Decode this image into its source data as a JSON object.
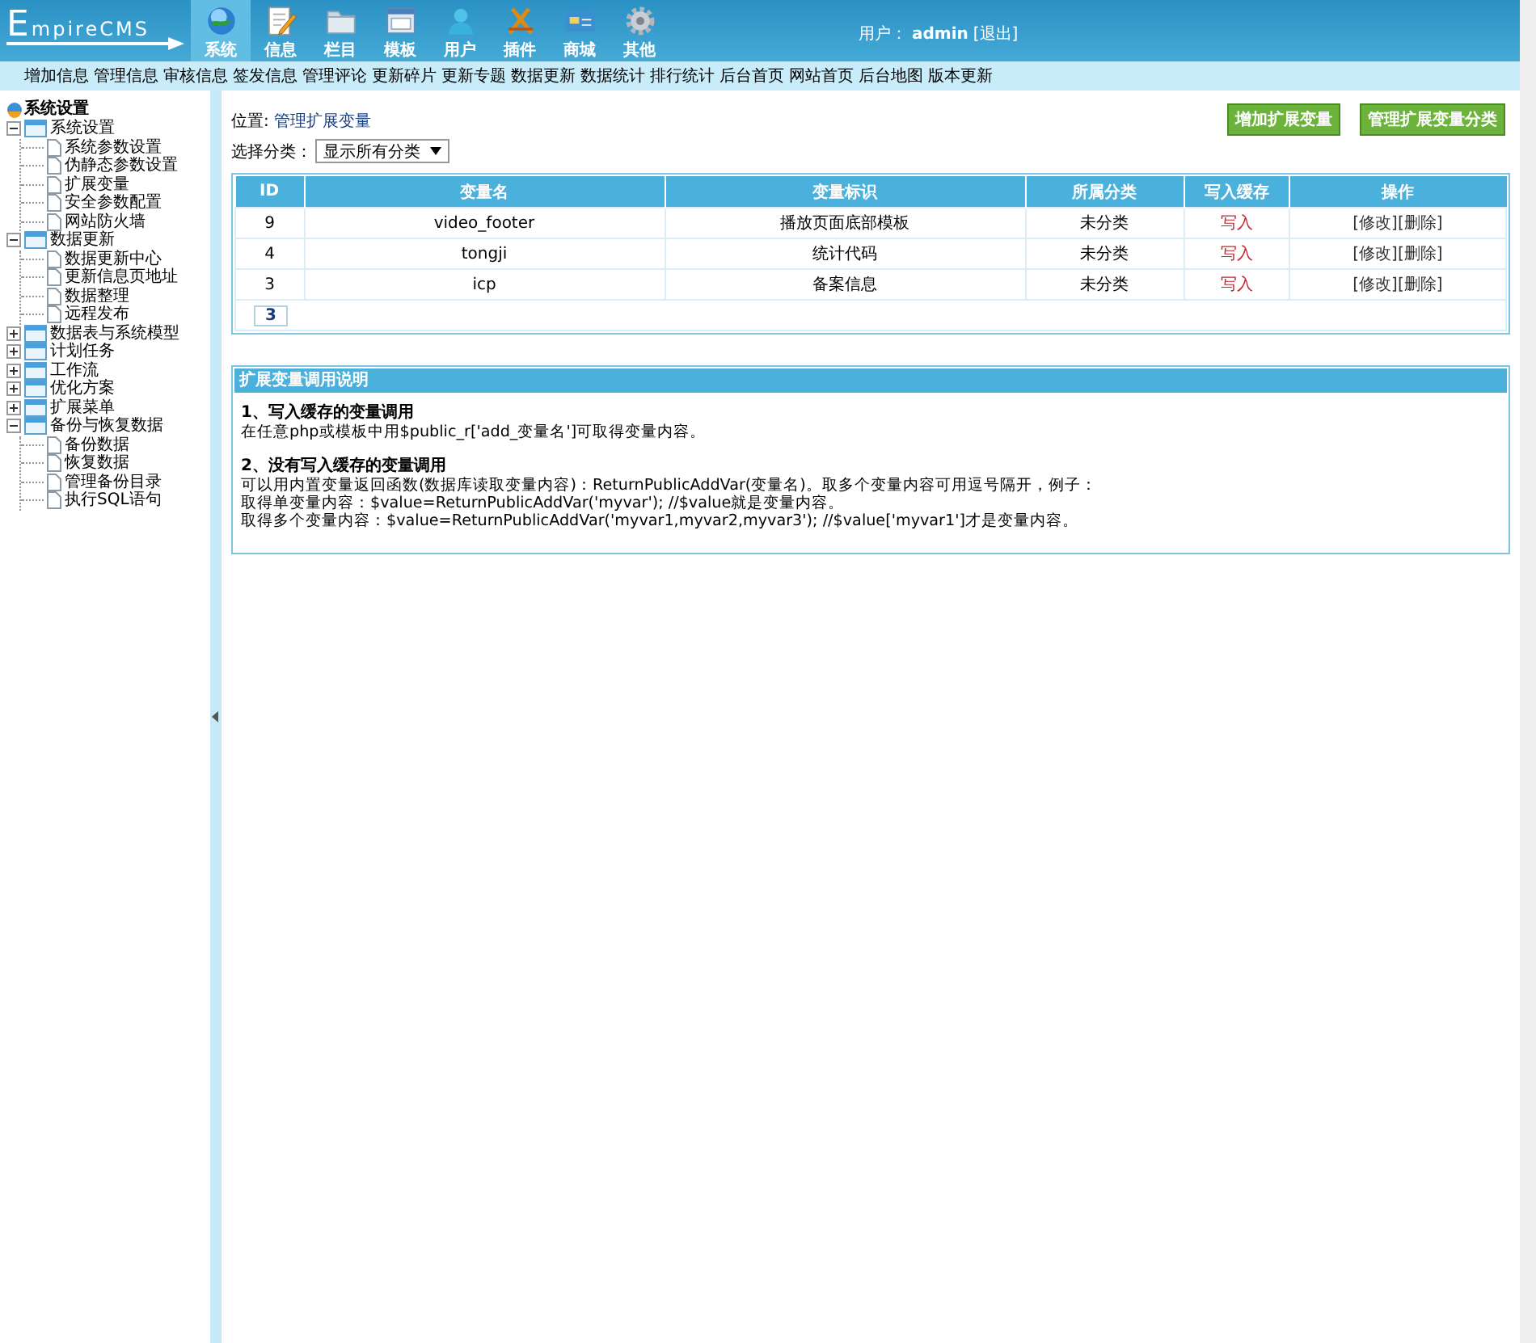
{
  "header": {
    "logo": "EmpireCMS",
    "nav": [
      {
        "kind": "globe",
        "label": "系统",
        "selected": true
      },
      {
        "kind": "pencil",
        "label": "信息",
        "selected": false
      },
      {
        "kind": "folder",
        "label": "栏目",
        "selected": false
      },
      {
        "kind": "window",
        "label": "模板",
        "selected": false
      },
      {
        "kind": "user",
        "label": "用户",
        "selected": false
      },
      {
        "kind": "tools",
        "label": "插件",
        "selected": false
      },
      {
        "kind": "card",
        "label": "商城",
        "selected": false
      },
      {
        "kind": "gear",
        "label": "其他",
        "selected": false
      }
    ],
    "user_label": "用户：",
    "username": "admin",
    "logout": "[退出]"
  },
  "submenu": [
    "增加信息",
    "管理信息",
    "审核信息",
    "签发信息",
    "管理评论",
    "更新碎片",
    "更新专题",
    "数据更新",
    "数据统计",
    "排行统计",
    "后台首页",
    "网站首页",
    "后台地图",
    "版本更新"
  ],
  "sidebar": {
    "title": "系统设置",
    "tree": [
      {
        "label": "系统设置",
        "expanded": true,
        "children": [
          {
            "label": "系统参数设置"
          },
          {
            "label": "伪静态参数设置"
          },
          {
            "label": "扩展变量"
          },
          {
            "label": "安全参数配置"
          },
          {
            "label": "网站防火墙"
          }
        ]
      },
      {
        "label": "数据更新",
        "expanded": true,
        "children": [
          {
            "label": "数据更新中心"
          },
          {
            "label": "更新信息页地址"
          },
          {
            "label": "数据整理"
          },
          {
            "label": "远程发布"
          }
        ]
      },
      {
        "label": "数据表与系统模型",
        "expanded": false
      },
      {
        "label": "计划任务",
        "expanded": false
      },
      {
        "label": "工作流",
        "expanded": false
      },
      {
        "label": "优化方案",
        "expanded": false
      },
      {
        "label": "扩展菜单",
        "expanded": false
      },
      {
        "label": "备份与恢复数据",
        "expanded": true,
        "children": [
          {
            "label": "备份数据"
          },
          {
            "label": "恢复数据"
          },
          {
            "label": "管理备份目录"
          },
          {
            "label": "执行SQL语句"
          }
        ]
      }
    ]
  },
  "content": {
    "location_label": "位置: ",
    "location_link": "管理扩展变量",
    "buttons": [
      "增加扩展变量",
      "管理扩展变量分类"
    ],
    "filter": {
      "label": "选择分类：",
      "value": "显示所有分类"
    },
    "table": {
      "columns": [
        "ID",
        "变量名",
        "变量标识",
        "所属分类",
        "写入缓存",
        "操作"
      ],
      "rows": [
        {
          "id": "9",
          "name": "video_footer",
          "mark": "播放页面底部模板",
          "category": "未分类",
          "cache": "写入",
          "actions": [
            "[修改]",
            "[删除]"
          ]
        },
        {
          "id": "4",
          "name": "tongji",
          "mark": "统计代码",
          "category": "未分类",
          "cache": "写入",
          "actions": [
            "[修改]",
            "[删除]"
          ]
        },
        {
          "id": "3",
          "name": "icp",
          "mark": "备案信息",
          "category": "未分类",
          "cache": "写入",
          "actions": [
            "[修改]",
            "[删除]"
          ]
        }
      ],
      "pagination": "3"
    },
    "notes": {
      "title": "扩展变量调用说明",
      "sections": [
        {
          "heading": "1、写入缓存的变量调用",
          "lines": [
            "在任意php或模板中用$public_r['add_变量名']可取得变量内容。"
          ]
        },
        {
          "heading": "2、没有写入缓存的变量调用",
          "lines": [
            "可以用内置变量返回函数(数据库读取变量内容)：ReturnPublicAddVar(变量名)。取多个变量内容可用逗号隔开，例子：",
            "取得单变量内容：$value=ReturnPublicAddVar('myvar'); //$value就是变量内容。",
            "取得多个变量内容：$value=ReturnPublicAddVar('myvar1,myvar2,myvar3'); //$value['myvar1']才是变量内容。"
          ]
        }
      ]
    }
  }
}
